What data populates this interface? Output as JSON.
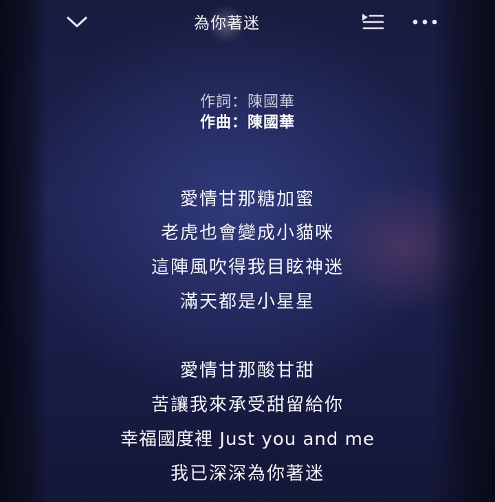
{
  "header": {
    "collapse_icon": "chevron-down-icon",
    "title": "為你著迷",
    "queue_icon": "playlist-queue-icon",
    "more_icon": "more-horizontal-icon"
  },
  "credits": {
    "lyricist": "作詞：陳國華",
    "composer": "作曲：陳國華"
  },
  "lyrics": {
    "verse1": [
      "愛情甘那糖加蜜",
      "老虎也會變成小貓咪",
      "這陣風吹得我目眩神迷",
      "滿天都是小星星"
    ],
    "verse2": [
      "愛情甘那酸甘甜",
      "苦讓我來承受甜留給你",
      "幸福國度裡 Just you and me",
      "我已深深為你著迷"
    ]
  },
  "colors": {
    "background_top": "#161a3a",
    "background_mid": "#1d2250",
    "text": "#f4f4f8",
    "credit_dim": "#cfd0da"
  }
}
